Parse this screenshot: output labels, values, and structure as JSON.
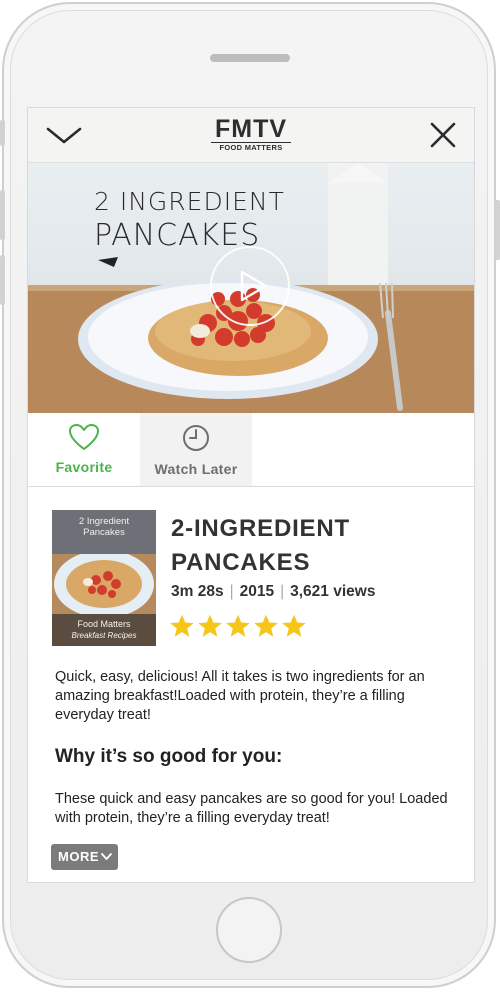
{
  "header": {
    "logo_main": "FMTV",
    "logo_sub": "FOOD MATTERS"
  },
  "video": {
    "title_line1": "2 INGREDIENT",
    "title_line2": "PANCAKES"
  },
  "actions": [
    {
      "label": "Favorite",
      "icon": "heart-icon",
      "color": "#4ab34a"
    },
    {
      "label": "Watch Later",
      "icon": "clock-icon",
      "color": "#6e6e6e"
    }
  ],
  "thumbnail": {
    "top_line1": "2 Ingredient",
    "top_line2": "Pancakes",
    "bottom_line1": "Food Matters",
    "bottom_line2": "Breakfast Recipes"
  },
  "details": {
    "title_line1": "2-INGREDIENT",
    "title_line2": "PANCAKES",
    "duration": "3m 28s",
    "year": "2015",
    "views": "3,621 views",
    "separator": "|",
    "rating": 5,
    "rating_max": 5,
    "star_color": "#f5c518"
  },
  "description": {
    "text": "Quick, easy, delicious! All it takes is two ingredients for an amazing breakfast!Loaded with protein, they’re a filling everyday treat!",
    "heading": "Why it’s so good for you:",
    "text2": "These quick and easy pancakes are so good for you! Loaded with protein, they’re a filling everyday treat!",
    "more_label": "MORE"
  }
}
